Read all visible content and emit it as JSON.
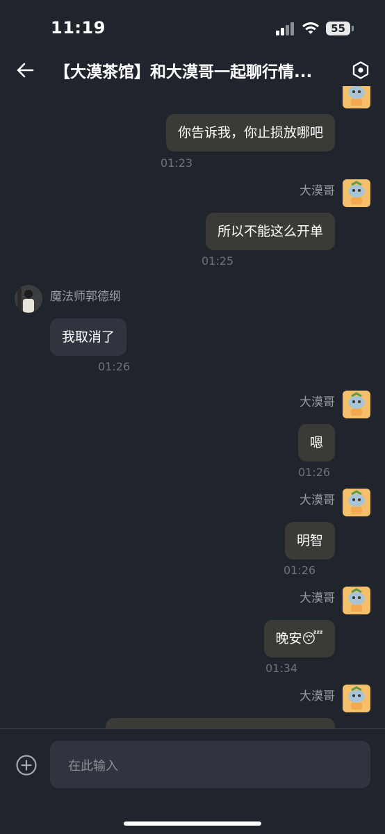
{
  "status_bar": {
    "time": "11:19",
    "battery": "55"
  },
  "header": {
    "title": "【大漠茶馆】和大漠哥一起聊行情..."
  },
  "messages": [
    {
      "type": "outgoing",
      "text": "你告诉我，你止损放哪吧",
      "time": "01:23"
    },
    {
      "type": "outgoing",
      "sender": "大漠哥",
      "text": "所以不能这么开单",
      "time": "01:25"
    },
    {
      "type": "incoming",
      "sender": "魔法师郭德纲",
      "text": "我取消了",
      "time": "01:26"
    },
    {
      "type": "outgoing",
      "sender": "大漠哥",
      "text": "嗯",
      "time": "01:26"
    },
    {
      "type": "outgoing",
      "sender": "大漠哥",
      "text": "明智",
      "time": "01:26"
    },
    {
      "type": "outgoing",
      "sender": "大漠哥",
      "text": "晚安",
      "emoji": "😴",
      "time": "01:34"
    },
    {
      "type": "outgoing",
      "sender": "大漠哥",
      "text": "",
      "time": ""
    }
  ],
  "input": {
    "placeholder": "在此输入"
  },
  "icons": {
    "back": "arrow-left-icon",
    "settings": "hexagon-settings-icon",
    "add": "plus-circle-icon",
    "wifi": "wifi-icon",
    "signal": "cellular-signal-icon"
  },
  "colors": {
    "background": "#20242d",
    "outgoing_bubble": "#3a3a36",
    "incoming_bubble": "#30343e",
    "mascot_avatar": "#f5c06c"
  }
}
